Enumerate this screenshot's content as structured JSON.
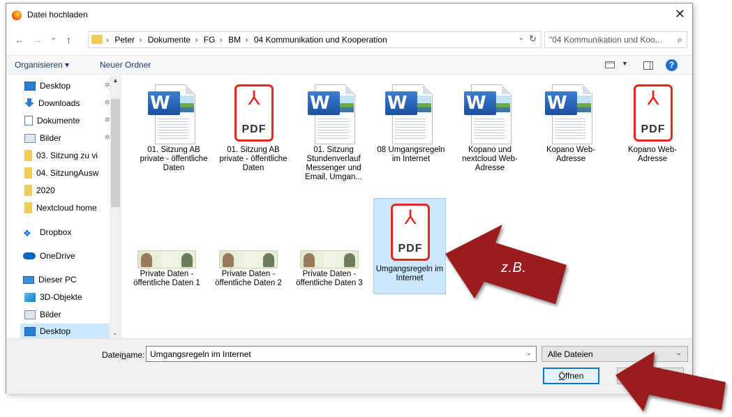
{
  "window": {
    "title": "Datei hochladen",
    "close": "✕"
  },
  "nav": {
    "back": "←",
    "forward": "→",
    "recent": "⌄",
    "up": "↑",
    "refresh": "↻",
    "dropdown": "⌄"
  },
  "breadcrumb": [
    "Peter",
    "Dokumente",
    "FG",
    "BM",
    "04 Kommunikation und Kooperation"
  ],
  "search": {
    "value": "\"04 Kommunikation und Koo...",
    "icon": "⌕"
  },
  "toolbar": {
    "organize": "Organisieren ▾",
    "new_folder": "Neuer Ordner",
    "view_dd": "▼",
    "help": "?"
  },
  "sidebar": {
    "items": [
      {
        "label": "Desktop",
        "icon": "desktop-icon",
        "pinned": true
      },
      {
        "label": "Downloads",
        "icon": "downloads-icon",
        "pinned": true
      },
      {
        "label": "Dokumente",
        "icon": "documents-icon",
        "pinned": true
      },
      {
        "label": "Bilder",
        "icon": "pictures-icon",
        "pinned": true
      },
      {
        "label": "03. Sitzung zu vi",
        "icon": "folder-icon"
      },
      {
        "label": "04. SitzungAusw",
        "icon": "folder-icon"
      },
      {
        "label": "2020",
        "icon": "folder-icon"
      },
      {
        "label": "Nextcloud home",
        "icon": "folder-icon"
      },
      {
        "label": "Dropbox",
        "icon": "dropbox-icon"
      },
      {
        "label": "OneDrive",
        "icon": "onedrive-icon"
      },
      {
        "label": "Dieser PC",
        "icon": "pc-icon"
      },
      {
        "label": "3D-Objekte",
        "icon": "3d-objects-icon"
      },
      {
        "label": "Bilder",
        "icon": "pictures-icon"
      },
      {
        "label": "Desktop",
        "icon": "desktop-icon",
        "selected": true
      }
    ],
    "pin_glyph": "✲",
    "scroll_up": "▲",
    "scroll_down": "⌄"
  },
  "files": [
    {
      "type": "word",
      "label": "01. Sitzung AB private - öffentliche Daten"
    },
    {
      "type": "pdf",
      "label": "01. Sitzung AB private - öffentliche Daten"
    },
    {
      "type": "word",
      "label": "01. Sitzung Stundenverlauf Messenger und Email, Umgan..."
    },
    {
      "type": "word",
      "label": "08 Umgangsregeln im Internet"
    },
    {
      "type": "word",
      "label": "Kopano und nextcloud Web-Adresse"
    },
    {
      "type": "word",
      "label": "Kopano Web-Adresse"
    },
    {
      "type": "pdf",
      "label": "Kopano Web-Adresse"
    },
    {
      "type": "image",
      "label": "Private Daten - öffentliche Daten 1"
    },
    {
      "type": "image",
      "label": "Private Daten - öffentliche Daten 2"
    },
    {
      "type": "image",
      "label": "Private Daten - öffentliche Daten 3"
    },
    {
      "type": "pdf",
      "label": "Umgangsregeln im Internet",
      "selected": true
    }
  ],
  "icons": {
    "word_letter": "W",
    "pdf_glyph": "⅄",
    "pdf_text": "PDF"
  },
  "bottom": {
    "filename_label_pre": "Datei",
    "filename_label_u": "n",
    "filename_label_post": "ame:",
    "filename_value": "Umgangsregeln im Internet",
    "filetype_value": "Alle Dateien",
    "open_u": "Ö",
    "open_rest": "ffnen",
    "dropdown": "⌄"
  },
  "annotation": {
    "label": "z.B.",
    "arrow_color": "#9b1c1c"
  }
}
